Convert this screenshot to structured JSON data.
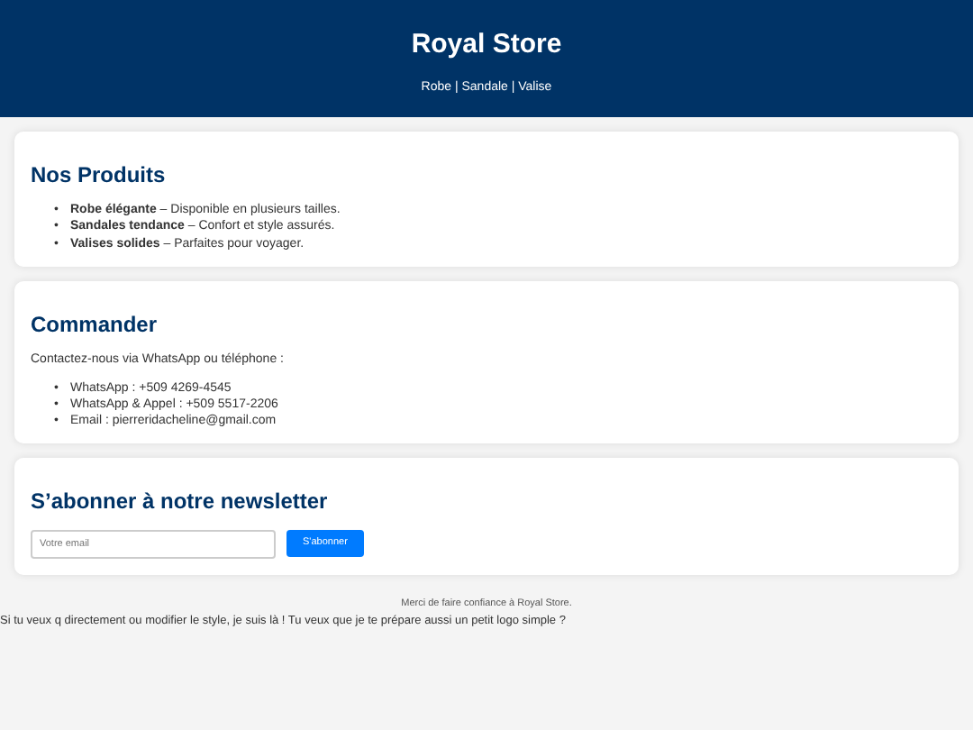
{
  "header": {
    "title": "Royal Store",
    "nav": "Robe | Sandale | Valise"
  },
  "products": {
    "title": "Nos Produits",
    "marker": "•",
    "items": [
      "**Robe élégante** – Disponible en plusieurs tailles.",
      "**Sandales tendance** – Confort et style assurés.",
      "**Valises solides** – Parfaites pour voyager."
    ]
  },
  "order": {
    "title": "Commander",
    "intro": "Contactez-nous via WhatsApp ou téléphone :",
    "marker": "•",
    "items": [
      "WhatsApp : +509 4269-4545",
      "WhatsApp & Appel : +509 5517-2206",
      "Email : pierreridacheline@gmail.com"
    ]
  },
  "newsletter": {
    "title": "S’abonner à notre newsletter",
    "placeholder": "Votre email",
    "button": "S'abonner"
  },
  "footer": "Merci de faire confiance à Royal Store.",
  "trailing_text": "Si tu veux q directement ou modifier le style, je suis là ! Tu veux que je te prépare aussi un petit logo simple ?"
}
